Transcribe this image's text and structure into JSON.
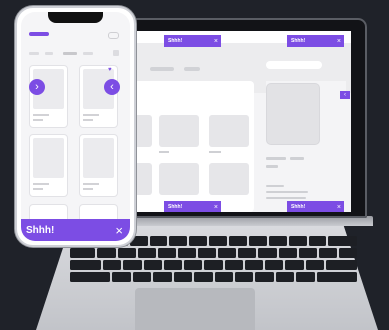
{
  "toasts": {
    "label": "Shhh!",
    "close": "×"
  },
  "phone": {
    "prev_arrow": "›",
    "next_arrow": "‹",
    "heart": "♥"
  },
  "laptop": {
    "side_arrow": "‹"
  },
  "colors": {
    "accent": "#7c4de4",
    "background": "#1f2229"
  }
}
